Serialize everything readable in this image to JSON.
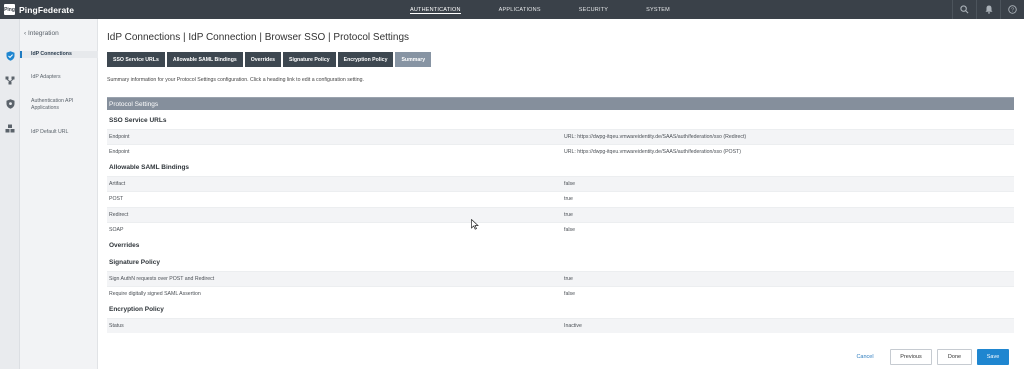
{
  "app": {
    "logo_text": "Ping",
    "name": "PingFederate"
  },
  "topnav": {
    "items": [
      {
        "label": "AUTHENTICATION"
      },
      {
        "label": "APPLICATIONS"
      },
      {
        "label": "SECURITY"
      },
      {
        "label": "SYSTEM"
      }
    ],
    "active": "AUTHENTICATION"
  },
  "top_icons": [
    "search-icon",
    "bell-icon",
    "help-icon"
  ],
  "rail_icons": [
    "shield-check-icon",
    "network-icon",
    "shield-icon",
    "cubes-icon"
  ],
  "subnav": {
    "back_label": "‹ Integration",
    "items": [
      {
        "label": "IdP Connections"
      },
      {
        "label": "IdP Adapters"
      },
      {
        "label": "Authentication API Applications"
      },
      {
        "label": "IdP Default URL"
      }
    ]
  },
  "page": {
    "title": "IdP Connections | IdP Connection | Browser SSO | Protocol Settings",
    "description": "Summary information for your Protocol Settings configuration. Click a heading link to edit a configuration setting."
  },
  "tabs": [
    {
      "label": "SSO Service URLs"
    },
    {
      "label": "Allowable SAML Bindings"
    },
    {
      "label": "Overrides"
    },
    {
      "label": "Signature Policy"
    },
    {
      "label": "Encryption Policy"
    },
    {
      "label": "Summary"
    }
  ],
  "summary": {
    "section_title": "Protocol Settings",
    "sso_heading": "SSO Service URLs",
    "sso_rows": [
      {
        "key": "Endpoint",
        "value": "URL: https://dwpg-itqeu.vmwareidentity.de/SAAS/auth/federation/sso (Redirect)"
      },
      {
        "key": "Endpoint",
        "value": "URL: https://dwpg-itqeu.vmwareidentity.de/SAAS/auth/federation/sso (POST)"
      }
    ],
    "bindings_heading": "Allowable SAML Bindings",
    "bindings_rows": [
      {
        "key": "Artifact",
        "value": "false"
      },
      {
        "key": "POST",
        "value": "true"
      },
      {
        "key": "Redirect",
        "value": "true"
      },
      {
        "key": "SOAP",
        "value": "false"
      }
    ],
    "overrides_heading": "Overrides",
    "signature_heading": "Signature Policy",
    "signature_rows": [
      {
        "key": "Sign AuthN requests over POST and Redirect",
        "value": "true"
      },
      {
        "key": "Require digitally signed SAML Assertion",
        "value": "false"
      }
    ],
    "encryption_heading": "Encryption Policy",
    "encryption_rows": [
      {
        "key": "Status",
        "value": "Inactive"
      }
    ]
  },
  "buttons": {
    "cancel": "Cancel",
    "previous": "Previous",
    "done": "Done",
    "save": "Save"
  },
  "colors": {
    "topbar": "#3a4149",
    "tab": "#3d4750",
    "tab_active": "#8794a3",
    "section_bar": "#858f9c",
    "primary": "#1f86d0"
  }
}
